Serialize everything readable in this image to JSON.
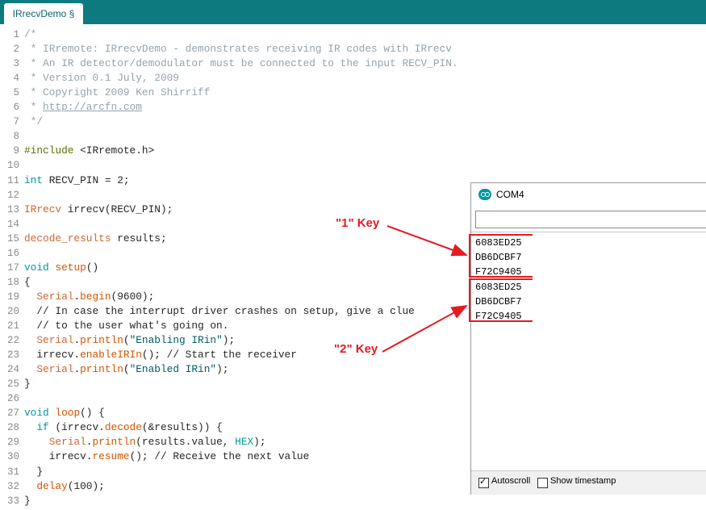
{
  "tab": {
    "label": "IRrecvDemo §"
  },
  "code_lines": [
    [
      {
        "t": "/*",
        "c": "cmt"
      }
    ],
    [
      {
        "t": " * IRremote: IRrecvDemo - demonstrates receiving IR codes with IRrecv",
        "c": "cmt"
      }
    ],
    [
      {
        "t": " * An IR detector/demodulator must be connected to the input RECV_PIN.",
        "c": "cmt"
      }
    ],
    [
      {
        "t": " * Version 0.1 July, 2009",
        "c": "cmt"
      }
    ],
    [
      {
        "t": " * Copyright 2009 Ken Shirriff",
        "c": "cmt"
      }
    ],
    [
      {
        "t": " * ",
        "c": "cmt"
      },
      {
        "t": "http://arcfn.com",
        "c": "url"
      }
    ],
    [
      {
        "t": " */",
        "c": "cmt"
      }
    ],
    [],
    [
      {
        "t": "#include",
        "c": "pp"
      },
      {
        "t": " <IRremote.h>"
      }
    ],
    [],
    [
      {
        "t": "int",
        "c": "kw"
      },
      {
        "t": " RECV_PIN = 2;"
      }
    ],
    [],
    [
      {
        "t": "IRrecv",
        "c": "typ"
      },
      {
        "t": " irrecv(RECV_PIN);"
      }
    ],
    [],
    [
      {
        "t": "decode_results",
        "c": "typ"
      },
      {
        "t": " results;"
      }
    ],
    [],
    [
      {
        "t": "void",
        "c": "kw"
      },
      {
        "t": " "
      },
      {
        "t": "setup",
        "c": "fn"
      },
      {
        "t": "()"
      }
    ],
    [
      {
        "t": "{"
      }
    ],
    [
      {
        "t": "  "
      },
      {
        "t": "Serial",
        "c": "typ"
      },
      {
        "t": "."
      },
      {
        "t": "begin",
        "c": "fn"
      },
      {
        "t": "(9600);"
      }
    ],
    [
      {
        "t": "  // In case the interrupt driver crashes on setup, give a clue"
      }
    ],
    [
      {
        "t": "  // to the user what's going on."
      }
    ],
    [
      {
        "t": "  "
      },
      {
        "t": "Serial",
        "c": "typ"
      },
      {
        "t": "."
      },
      {
        "t": "println",
        "c": "fn"
      },
      {
        "t": "("
      },
      {
        "t": "\"Enabling IRin\"",
        "c": "str"
      },
      {
        "t": ");"
      }
    ],
    [
      {
        "t": "  irrecv."
      },
      {
        "t": "enableIRIn",
        "c": "fn"
      },
      {
        "t": "(); // Start the receiver"
      }
    ],
    [
      {
        "t": "  "
      },
      {
        "t": "Serial",
        "c": "typ"
      },
      {
        "t": "."
      },
      {
        "t": "println",
        "c": "fn"
      },
      {
        "t": "("
      },
      {
        "t": "\"Enabled IRin\"",
        "c": "str"
      },
      {
        "t": ");"
      }
    ],
    [
      {
        "t": "}"
      }
    ],
    [],
    [
      {
        "t": "void",
        "c": "kw"
      },
      {
        "t": " "
      },
      {
        "t": "loop",
        "c": "fn"
      },
      {
        "t": "() {"
      }
    ],
    [
      {
        "t": "  "
      },
      {
        "t": "if",
        "c": "kw"
      },
      {
        "t": " (irrecv."
      },
      {
        "t": "decode",
        "c": "fn"
      },
      {
        "t": "(&results)) {"
      }
    ],
    [
      {
        "t": "    "
      },
      {
        "t": "Serial",
        "c": "typ"
      },
      {
        "t": "."
      },
      {
        "t": "println",
        "c": "fn"
      },
      {
        "t": "(results.value, "
      },
      {
        "t": "HEX",
        "c": "kw"
      },
      {
        "t": ");"
      }
    ],
    [
      {
        "t": "    irrecv."
      },
      {
        "t": "resume",
        "c": "fn"
      },
      {
        "t": "(); // Receive the next value"
      }
    ],
    [
      {
        "t": "  }"
      }
    ],
    [
      {
        "t": "  "
      },
      {
        "t": "delay",
        "c": "fn"
      },
      {
        "t": "(100);"
      }
    ],
    [
      {
        "t": "}"
      }
    ]
  ],
  "serial": {
    "title": "COM4",
    "output": [
      "6083ED25",
      "DB6DCBF7",
      "F72C9405",
      "6083ED25",
      "DB6DCBF7",
      "F72C9405"
    ],
    "autoscroll_label": "Autoscroll",
    "autoscroll_checked": true,
    "timestamp_label": "Show timestamp",
    "timestamp_checked": false
  },
  "annotations": {
    "key1": "\"1\" Key",
    "key2": "\"2\" Key",
    "color": "#e31b23"
  }
}
